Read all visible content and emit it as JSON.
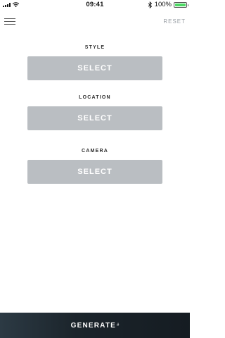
{
  "status_bar": {
    "time": "09:41",
    "battery_percent": "100%",
    "battery_level": 1.0
  },
  "nav": {
    "reset_label": "RESET"
  },
  "sections": [
    {
      "label": "STYLE",
      "button_label": "SELECT"
    },
    {
      "label": "LOCATION",
      "button_label": "SELECT"
    },
    {
      "label": "CAMERA",
      "button_label": "SELECT"
    }
  ],
  "generate": {
    "label": "GENERATE",
    "mark": "#"
  },
  "colors": {
    "select_button_bg": "#babec2",
    "battery_fill": "#4cd964",
    "generate_bar_bg": "#1b242b"
  }
}
